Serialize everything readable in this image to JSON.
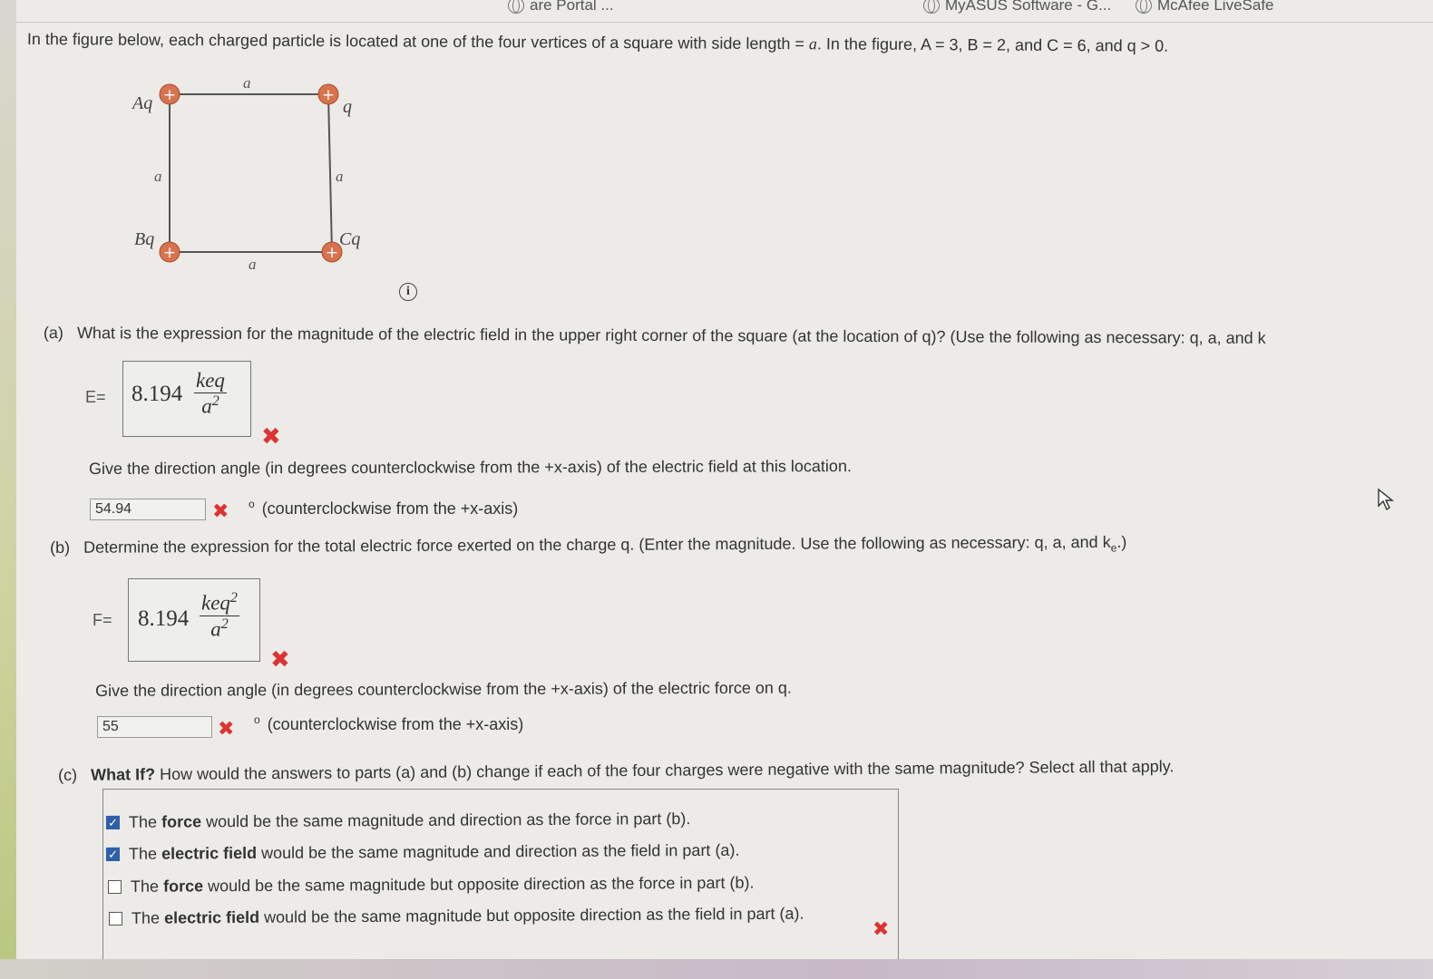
{
  "bookmarks": [
    {
      "label": "are Portal ...",
      "icon": "globe-icon"
    },
    {
      "label": "MyASUS Software - G...",
      "icon": "globe-icon"
    },
    {
      "label": "McAfee LiveSafe",
      "icon": "globe-icon"
    }
  ],
  "problem": {
    "intro_pre": "In the figure below, each charged particle is located at one of the four vertices of a square with side length = ",
    "intro_a": "a",
    "intro_post": ". In the figure, A = 3, B = 2, and C = 6, and q > 0."
  },
  "figure": {
    "side_label": "a",
    "charge_top_left": "Aq",
    "charge_top_right": "q",
    "charge_bottom_left": "Bq",
    "charge_bottom_right": "Cq",
    "plus": "+"
  },
  "part_a": {
    "label": "(a)",
    "question": "What is the expression for the magnitude of the electric field in the upper right corner of the square (at the location of q)? (Use the following as necessary: q, a, and k",
    "eq_var": "E",
    "eq_sign": "=",
    "answer_coef": "8.194",
    "answer_num": "keq",
    "answer_den": "a",
    "answer_den_exp": "2",
    "direction_question": "Give the direction angle (in degrees counterclockwise from the +x-axis) of the electric field at this location.",
    "direction_value": "54.94",
    "direction_unit": "(counterclockwise from the +x-axis)",
    "degree_symbol": "o",
    "result": "incorrect"
  },
  "part_b": {
    "label": "(b)",
    "question": "Determine the expression for the total electric force exerted on the charge q. (Enter the magnitude. Use the following as necessary: q, a, and k",
    "question_sub": "e",
    "question_end": ".)",
    "eq_var": "F",
    "eq_sign": "=",
    "answer_coef": "8.194",
    "answer_num": "keq",
    "answer_num_exp": "2",
    "answer_den": "a",
    "answer_den_exp": "2",
    "direction_question": "Give the direction angle (in degrees counterclockwise from the +x-axis) of the electric force on q.",
    "direction_value": "55",
    "direction_unit": "(counterclockwise from the +x-axis)",
    "degree_symbol": "o",
    "result": "incorrect"
  },
  "part_c": {
    "label": "(c)",
    "what_if": "What If?",
    "question": "How would the answers to parts (a) and (b) change if each of the four charges were negative with the same magnitude? Select all that apply.",
    "options": [
      {
        "pre": "The ",
        "bold": "force",
        "post": " would be the same magnitude and direction as the force in part (b).",
        "checked": true
      },
      {
        "pre": "The ",
        "bold": "electric field",
        "post": " would be the same magnitude and direction as the field in part (a).",
        "checked": true
      },
      {
        "pre": "The ",
        "bold": "force",
        "post": " would be the same magnitude but opposite direction as the force in part (b).",
        "checked": false
      },
      {
        "pre": "The ",
        "bold": "electric field",
        "post": " would be the same magnitude but opposite direction as the field in part (a).",
        "checked": false
      }
    ],
    "result": "incorrect"
  },
  "marks": {
    "wrong": "✖"
  },
  "colors": {
    "wrong": "#d33333",
    "checkbox_checked": "#2f5fa8",
    "charge_fill": "#d9734e"
  }
}
